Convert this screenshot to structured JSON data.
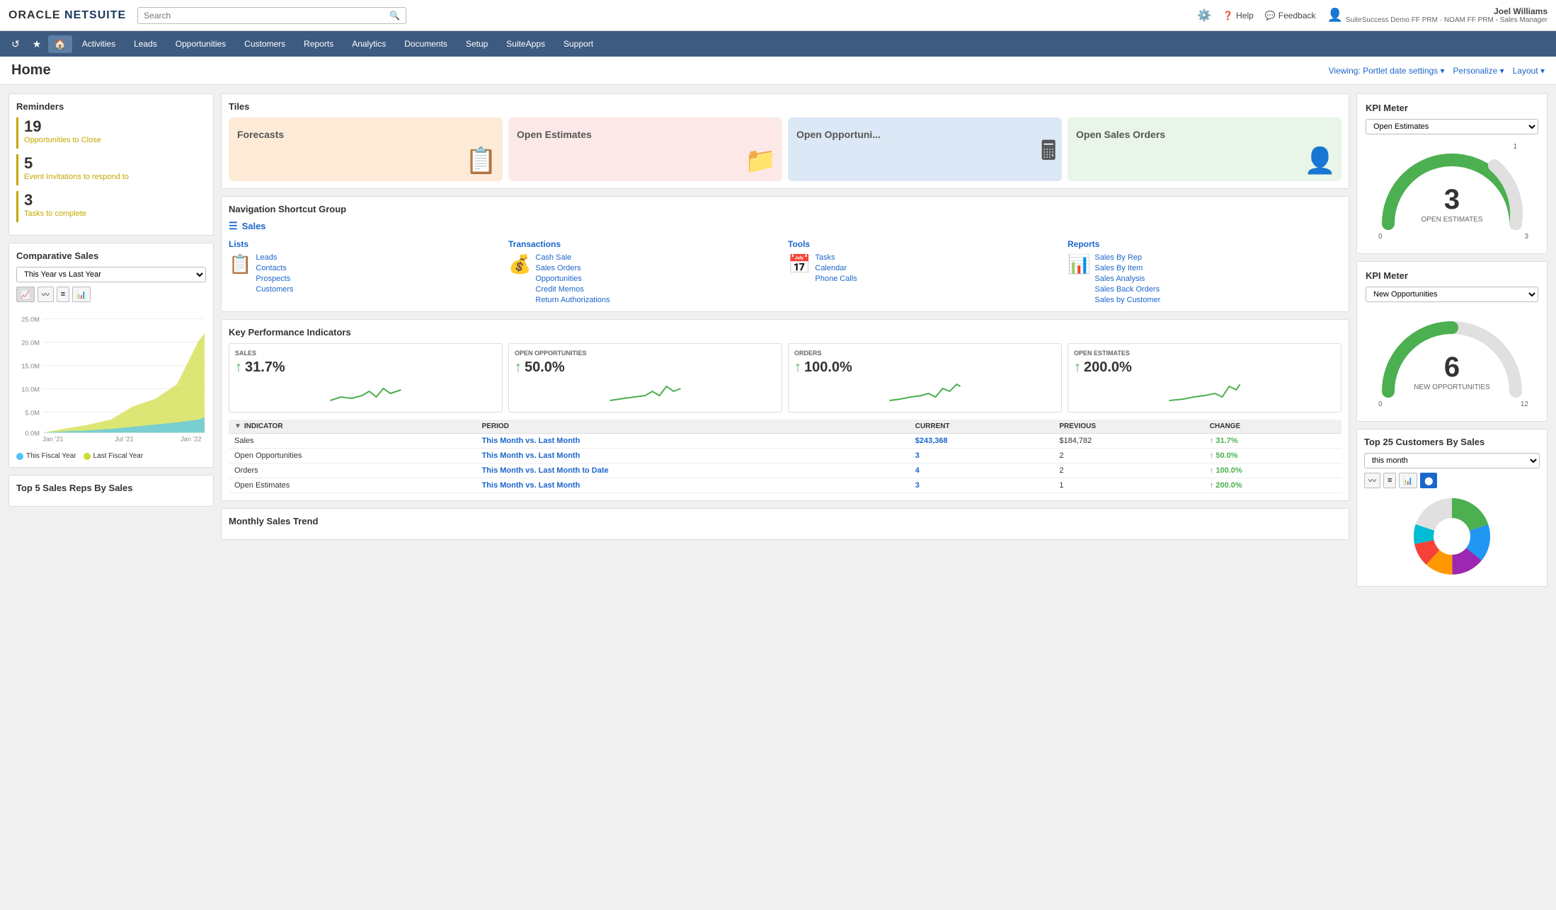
{
  "app": {
    "logo_oracle": "ORACLE",
    "logo_netsuite": "NETSUITE"
  },
  "header": {
    "search_placeholder": "Search",
    "help": "Help",
    "feedback": "Feedback",
    "user_name": "Joel Williams",
    "user_subtitle": "SuiteSuccess Demo FF PRM · NOAM FF PRM - Sales Manager"
  },
  "nav": {
    "items": [
      "Activities",
      "Leads",
      "Opportunities",
      "Customers",
      "Reports",
      "Analytics",
      "Documents",
      "Setup",
      "SuiteApps",
      "Support"
    ]
  },
  "page": {
    "title": "Home",
    "viewing_label": "Viewing: Portlet date settings ▾",
    "personalize": "Personalize ▾",
    "layout": "Layout ▾"
  },
  "reminders": {
    "title": "Reminders",
    "items": [
      {
        "number": "19",
        "label": "Opportunities to Close"
      },
      {
        "number": "5",
        "label": "Event Invitations to respond to"
      },
      {
        "number": "3",
        "label": "Tasks to complete"
      }
    ]
  },
  "comparative_sales": {
    "title": "Comparative Sales",
    "select_value": "This Year vs Last Year",
    "chart_icons": [
      "area",
      "line",
      "list",
      "bar"
    ],
    "y_labels": [
      "25.0M",
      "20.0M",
      "15.0M",
      "10.0M",
      "5.0M",
      "0.0M"
    ],
    "x_labels": [
      "Jan '21",
      "Jul '21",
      "Jan '22"
    ],
    "legend": [
      {
        "color": "#4fc3f7",
        "label": "This Fiscal Year"
      },
      {
        "color": "#cddc39",
        "label": "Last Fiscal Year"
      }
    ]
  },
  "tiles": {
    "title": "Tiles",
    "items": [
      {
        "label": "Forecasts",
        "bg": "tile-forecasts",
        "icon": "📋"
      },
      {
        "label": "Open Estimates",
        "bg": "tile-estimates",
        "icon": "📁"
      },
      {
        "label": "Open Opportuni...",
        "bg": "tile-opportunities",
        "icon": "🖩"
      },
      {
        "label": "Open Sales Orders",
        "bg": "tile-sales-orders",
        "icon": "👤"
      }
    ]
  },
  "nav_shortcut": {
    "title": "Navigation Shortcut Group",
    "group_name": "Sales",
    "columns": [
      {
        "title": "Lists",
        "links": [
          "Leads",
          "Contacts",
          "Prospects",
          "Customers"
        ]
      },
      {
        "title": "Transactions",
        "links": [
          "Cash Sale",
          "Sales Orders",
          "Opportunities",
          "Credit Memos",
          "Return Authorizations"
        ]
      },
      {
        "title": "Tools",
        "links": [
          "Tasks",
          "Calendar",
          "Phone Calls"
        ]
      },
      {
        "title": "Reports",
        "links": [
          "Sales By Rep",
          "Sales By Item",
          "Sales Analysis",
          "Sales Back Orders",
          "Sales by Customer"
        ]
      }
    ]
  },
  "kpi": {
    "title": "Key Performance Indicators",
    "cards": [
      {
        "label": "SALES",
        "value": "↑ 31.7%",
        "arrow": "↑",
        "pct": "31.7%"
      },
      {
        "label": "OPEN OPPORTUNITIES",
        "value": "↑ 50.0%",
        "arrow": "↑",
        "pct": "50.0%"
      },
      {
        "label": "ORDERS",
        "value": "↑ 100.0%",
        "arrow": "↑",
        "pct": "100.0%"
      },
      {
        "label": "OPEN ESTIMATES",
        "value": "↑ 200.0%",
        "arrow": "↑",
        "pct": "200.0%"
      }
    ],
    "table": {
      "headers": [
        "INDICATOR",
        "PERIOD",
        "CURRENT",
        "PREVIOUS",
        "CHANGE"
      ],
      "rows": [
        {
          "indicator": "Sales",
          "period": "This Month vs. Last Month",
          "current": "$243,368",
          "previous": "$184,782",
          "change": "↑ 31.7%"
        },
        {
          "indicator": "Open Opportunities",
          "period": "This Month vs. Last Month",
          "current": "3",
          "previous": "2",
          "change": "↑ 50.0%"
        },
        {
          "indicator": "Orders",
          "period": "This Month vs. Last Month to Date",
          "current": "4",
          "previous": "2",
          "change": "↑ 100.0%"
        },
        {
          "indicator": "Open Estimates",
          "period": "This Month vs. Last Month",
          "current": "3",
          "previous": "1",
          "change": "↑ 200.0%"
        }
      ]
    }
  },
  "kpi_meter1": {
    "title": "KPI Meter",
    "select_value": "Open Estimates",
    "value": "3",
    "label": "OPEN ESTIMATES",
    "tick_left": "0",
    "tick_top": "1",
    "tick_right": "3"
  },
  "kpi_meter2": {
    "title": "KPI Meter",
    "select_value": "New Opportunities",
    "value": "6",
    "label": "NEW OPPORTUNITIES",
    "tick_left": "0",
    "tick_right": "12"
  },
  "top_customers": {
    "title": "Top 25 Customers By Sales",
    "select_value": "this month"
  },
  "monthly_trend": {
    "title": "Monthly Sales Trend"
  },
  "top5_reps": {
    "title": "Top 5 Sales Reps By Sales"
  }
}
